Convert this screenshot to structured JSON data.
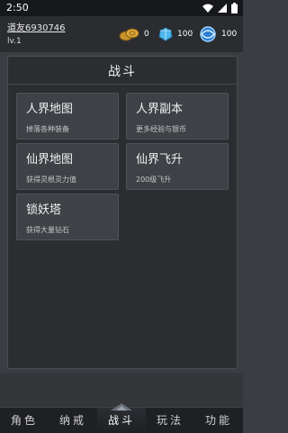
{
  "status_bar": {
    "time": "2:50"
  },
  "header": {
    "player_name": "道友6930746",
    "level": "lv.1",
    "gold": "0",
    "gems": "100",
    "crystals": "100"
  },
  "panel": {
    "title": "战斗",
    "cards": [
      {
        "name": "人界地图",
        "desc": "掉落各种装备"
      },
      {
        "name": "人界副本",
        "desc": "更多经验与银币"
      },
      {
        "name": "仙界地图",
        "desc": "获得灵根灵力值"
      },
      {
        "name": "仙界飞升",
        "desc": "200级飞升"
      },
      {
        "name": "锁妖塔",
        "desc": "获得大量钻石"
      }
    ]
  },
  "tabs": [
    "角色",
    "纳戒",
    "战斗",
    "玩法",
    "功能"
  ],
  "active_tab": "战斗",
  "colors": {
    "background": "#3a3d42",
    "card": "#3e4146",
    "tabbar": "#1e2023"
  }
}
